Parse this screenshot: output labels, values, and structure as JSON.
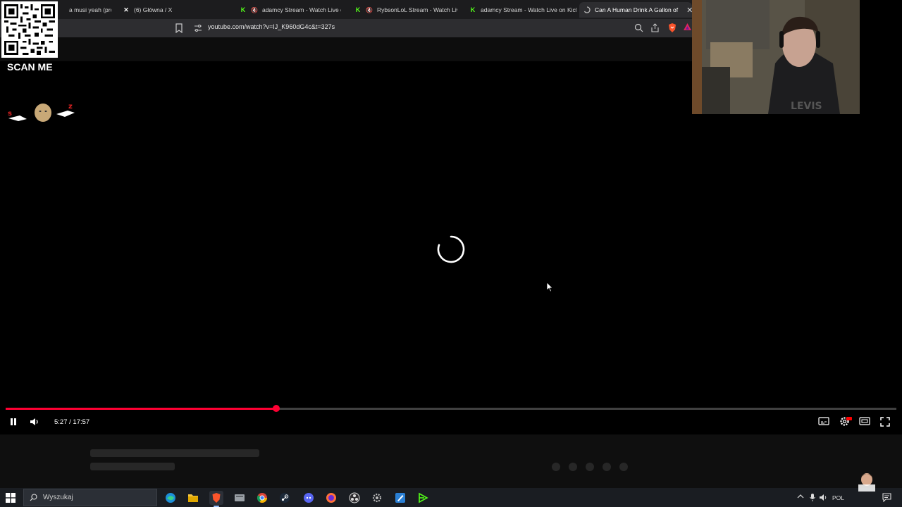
{
  "browser": {
    "tabs": [
      {
        "title": "a musi yeah (prod.",
        "icon": "music-icon",
        "muted": false,
        "active": false
      },
      {
        "title": "(6) Główna / X",
        "icon": "x-logo-icon",
        "muted": false,
        "active": false
      },
      {
        "title": "adamcy Stream - Watch Live on K",
        "icon": "kick-logo-icon",
        "muted": true,
        "active": false
      },
      {
        "title": "RybsonLoL Stream - Watch Live o",
        "icon": "kick-logo-icon",
        "muted": true,
        "active": false
      },
      {
        "title": "adamcy Stream - Watch Live on Kick",
        "icon": "kick-logo-icon",
        "muted": false,
        "active": false
      },
      {
        "title": "Can A Human Drink A Gallon of",
        "icon": "loading-icon",
        "muted": false,
        "active": true
      }
    ],
    "url": "youtube.com/watch?v=IJ_K960dG4c&t=327s"
  },
  "overlay": {
    "scan_label": "SCAN ME"
  },
  "player": {
    "time": "5:27 / 17:57",
    "progress": 0.304,
    "state": "buffering",
    "accent_color": "#ff0033"
  },
  "taskbar": {
    "search_placeholder": "Wyszukaj",
    "language": "POL",
    "apps": [
      "edge-icon",
      "file-explorer-icon",
      "brave-icon",
      "app-icon",
      "chrome-icon",
      "steam-icon",
      "discord-icon",
      "firefox-icon",
      "obs-icon",
      "settings-icon",
      "paint-icon",
      "media-icon"
    ]
  }
}
